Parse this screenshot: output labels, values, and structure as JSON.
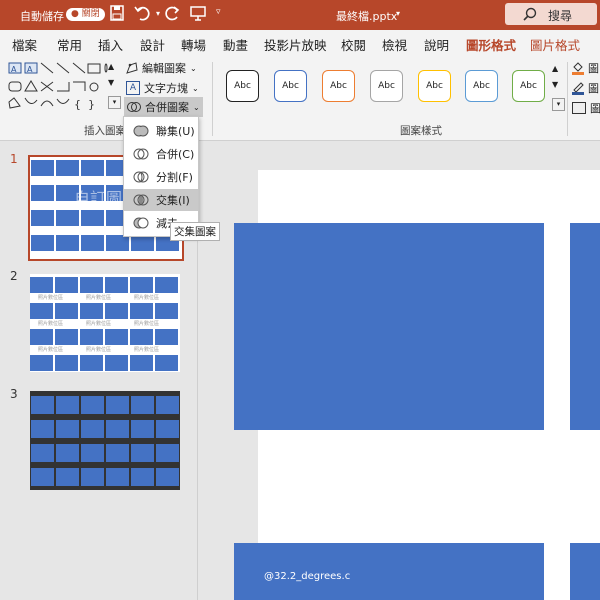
{
  "titlebar": {
    "autosave_label": "自動儲存",
    "autosave_state": "關閉",
    "file_name": "最終檔.pptx",
    "search_placeholder": "搜尋"
  },
  "tabs": [
    "檔案",
    "常用",
    "插入",
    "設計",
    "轉場",
    "動畫",
    "投影片放映",
    "校閱",
    "檢視",
    "說明",
    "圖形格式",
    "圖片格式"
  ],
  "active_tab": "圖形格式",
  "ribbon": {
    "edit_shape_label": "編輯圖案",
    "text_box_label": "文字方塊",
    "merge_shapes_label": "合併圖案",
    "insert_shapes_group": "插入圖案",
    "shape_styles_group": "圖案樣式",
    "style_sample_text": "Abc",
    "style_colors": [
      "#222222",
      "#4472c4",
      "#ed7d31",
      "#a5a5a5",
      "#ffc000",
      "#5b9bd5",
      "#70ad47"
    ],
    "right_items": [
      "圖",
      "圖",
      "圖"
    ]
  },
  "merge_menu": {
    "items": [
      "聯集(U)",
      "合併(C)",
      "分割(F)",
      "交集(I)",
      "減去"
    ],
    "selected": "交集(I)",
    "tooltip": "交集圖案"
  },
  "slides": {
    "numbers": [
      "1",
      "2",
      "3"
    ],
    "thumb1_overlay": "自訂圖",
    "thumb2_caption": "照片數位區"
  },
  "canvas": {
    "watermark": "@32.2_degrees.c"
  },
  "colors": {
    "accent": "#b7472a",
    "shape_fill": "#4472c4"
  }
}
